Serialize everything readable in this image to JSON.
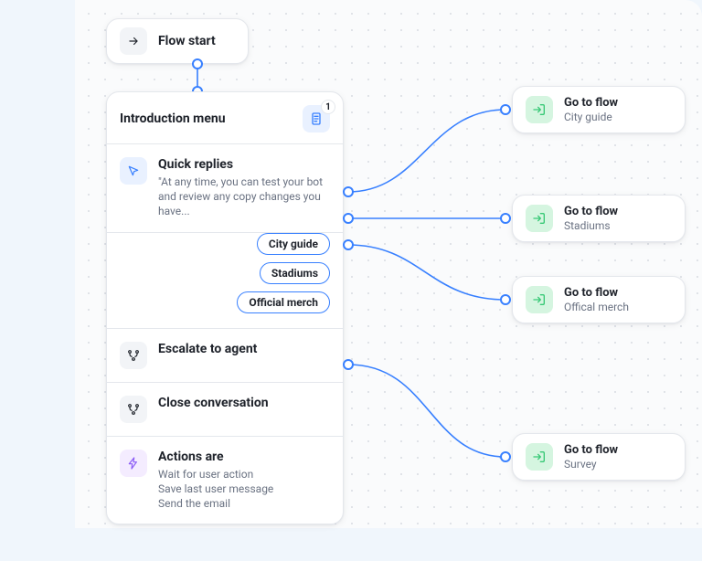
{
  "flow_start_label": "Flow start",
  "intro": {
    "title": "Introduction menu",
    "badge_count": "1",
    "quick_replies": {
      "title": "Quick replies",
      "subtitle": "\"At any time, you can test your bot and review any copy changes you have...",
      "options": [
        "City guide",
        "Stadiums",
        "Official merch"
      ]
    },
    "escalate_label": "Escalate to agent",
    "close_label": "Close conversation",
    "actions": {
      "title": "Actions are",
      "lines": [
        "Wait for user action",
        "Save last user message",
        "Send the email"
      ]
    }
  },
  "targets": {
    "goto_label": "Go to flow",
    "city_guide": "City guide",
    "stadiums": "Stadiums",
    "official_merch": "Offical merch",
    "survey": "Survey"
  }
}
